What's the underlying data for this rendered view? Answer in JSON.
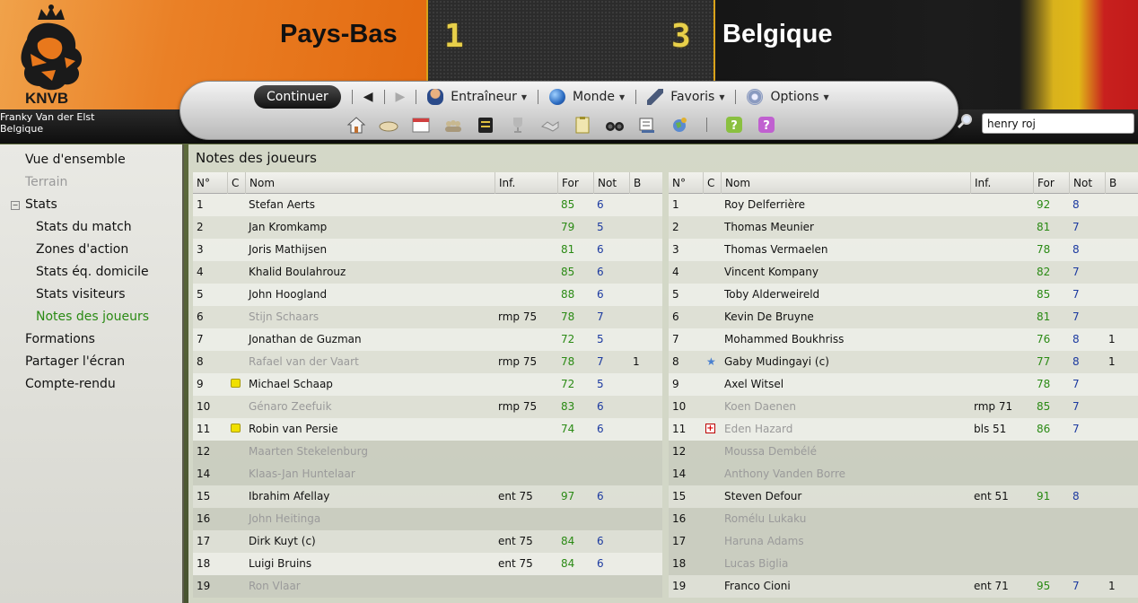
{
  "header": {
    "club_logo_text": "KNVB",
    "home_team": "Pays-Bas",
    "away_team": "Belgique",
    "home_score": "1",
    "away_score": "3",
    "manager_name": "Franky Van der Elst",
    "manager_nation": "Belgique",
    "colors": {
      "home": "#e8761c",
      "score_digits": "#e8d04a",
      "away": "#1a1a1a"
    }
  },
  "toolbar": {
    "continue_label": "Continuer",
    "back_icon": "back-arrow-icon",
    "forward_icon": "forward-arrow-icon",
    "menus": [
      {
        "label": "Entraîneur",
        "icon": "manager-icon"
      },
      {
        "label": "Monde",
        "icon": "globe-icon"
      },
      {
        "label": "Favoris",
        "icon": "pen-icon"
      },
      {
        "label": "Options",
        "icon": "settings-gears-icon"
      }
    ],
    "quick_icons": [
      "home-icon",
      "inbox-icon",
      "calendar-icon",
      "squad-icon",
      "tactics-board-icon",
      "trophy-icon",
      "handshake-icon",
      "notes-clipboard-icon",
      "binoculars-icon",
      "finance-icon",
      "world-icon",
      "help-icon",
      "support-icon"
    ],
    "search_value": "henry roj"
  },
  "sidebar": {
    "items": [
      {
        "label": "Vue d'ensemble",
        "state": "normal"
      },
      {
        "label": "Terrain",
        "state": "dim"
      },
      {
        "label": "Stats",
        "state": "normal"
      },
      {
        "label": "Stats du match",
        "state": "normal"
      },
      {
        "label": "Zones d'action",
        "state": "normal"
      },
      {
        "label": "Stats éq. domicile",
        "state": "normal"
      },
      {
        "label": "Stats visiteurs",
        "state": "normal"
      },
      {
        "label": "Notes des joueurs",
        "state": "active"
      },
      {
        "label": "Formations",
        "state": "normal"
      },
      {
        "label": "Partager l'écran",
        "state": "normal"
      },
      {
        "label": "Compte-rendu",
        "state": "normal"
      }
    ]
  },
  "main": {
    "title": "Notes des joueurs",
    "columns": [
      "N°",
      "C",
      "Nom",
      "Inf.",
      "For",
      "Not",
      "B"
    ],
    "home_rows": [
      {
        "no": "1",
        "c": "",
        "name": "Stefan Aerts",
        "inf": "",
        "for": "85",
        "not": "6",
        "b": "",
        "dim": false
      },
      {
        "no": "2",
        "c": "",
        "name": "Jan Kromkamp",
        "inf": "",
        "for": "79",
        "not": "5",
        "b": "",
        "dim": false
      },
      {
        "no": "3",
        "c": "",
        "name": "Joris Mathijsen",
        "inf": "",
        "for": "81",
        "not": "6",
        "b": "",
        "dim": false
      },
      {
        "no": "4",
        "c": "",
        "name": "Khalid Boulahrouz",
        "inf": "",
        "for": "85",
        "not": "6",
        "b": "",
        "dim": false
      },
      {
        "no": "5",
        "c": "",
        "name": "John Hoogland",
        "inf": "",
        "for": "88",
        "not": "6",
        "b": "",
        "dim": false
      },
      {
        "no": "6",
        "c": "",
        "name": "Stijn Schaars",
        "inf": "rmp 75",
        "for": "78",
        "not": "7",
        "b": "",
        "dim": true
      },
      {
        "no": "7",
        "c": "",
        "name": "Jonathan de Guzman",
        "inf": "",
        "for": "72",
        "not": "5",
        "b": "",
        "dim": false
      },
      {
        "no": "8",
        "c": "",
        "name": "Rafael van der Vaart",
        "inf": "rmp 75",
        "for": "78",
        "not": "7",
        "b": "1",
        "dim": true
      },
      {
        "no": "9",
        "c": "yellow-card",
        "name": "Michael Schaap",
        "inf": "",
        "for": "72",
        "not": "5",
        "b": "",
        "dim": false
      },
      {
        "no": "10",
        "c": "",
        "name": "Génaro Zeefuik",
        "inf": "rmp 75",
        "for": "83",
        "not": "6",
        "b": "",
        "dim": true
      },
      {
        "no": "11",
        "c": "yellow-card",
        "name": "Robin van Persie",
        "inf": "",
        "for": "74",
        "not": "6",
        "b": "",
        "dim": false
      },
      {
        "no": "12",
        "c": "",
        "name": "Maarten Stekelenburg",
        "inf": "",
        "for": "",
        "not": "",
        "b": "",
        "dim": true
      },
      {
        "no": "14",
        "c": "",
        "name": "Klaas-Jan Huntelaar",
        "inf": "",
        "for": "",
        "not": "",
        "b": "",
        "dim": true
      },
      {
        "no": "15",
        "c": "",
        "name": "Ibrahim Afellay",
        "inf": "ent 75",
        "for": "97",
        "not": "6",
        "b": "",
        "dim": false
      },
      {
        "no": "16",
        "c": "",
        "name": "John Heitinga",
        "inf": "",
        "for": "",
        "not": "",
        "b": "",
        "dim": true
      },
      {
        "no": "17",
        "c": "",
        "name": "Dirk Kuyt (c)",
        "inf": "ent 75",
        "for": "84",
        "not": "6",
        "b": "",
        "dim": false
      },
      {
        "no": "18",
        "c": "",
        "name": "Luigi Bruins",
        "inf": "ent 75",
        "for": "84",
        "not": "6",
        "b": "",
        "dim": false
      },
      {
        "no": "19",
        "c": "",
        "name": "Ron Vlaar",
        "inf": "",
        "for": "",
        "not": "",
        "b": "",
        "dim": true
      }
    ],
    "away_rows": [
      {
        "no": "1",
        "c": "",
        "name": "Roy Delferrière",
        "inf": "",
        "for": "92",
        "not": "8",
        "b": "",
        "dim": false
      },
      {
        "no": "2",
        "c": "",
        "name": "Thomas Meunier",
        "inf": "",
        "for": "81",
        "not": "7",
        "b": "",
        "dim": false
      },
      {
        "no": "3",
        "c": "",
        "name": "Thomas Vermaelen",
        "inf": "",
        "for": "78",
        "not": "8",
        "b": "",
        "dim": false
      },
      {
        "no": "4",
        "c": "",
        "name": "Vincent Kompany",
        "inf": "",
        "for": "82",
        "not": "7",
        "b": "",
        "dim": false
      },
      {
        "no": "5",
        "c": "",
        "name": "Toby Alderweireld",
        "inf": "",
        "for": "85",
        "not": "7",
        "b": "",
        "dim": false
      },
      {
        "no": "6",
        "c": "",
        "name": "Kevin De Bruyne",
        "inf": "",
        "for": "81",
        "not": "7",
        "b": "",
        "dim": false
      },
      {
        "no": "7",
        "c": "",
        "name": "Mohammed Boukhriss",
        "inf": "",
        "for": "76",
        "not": "8",
        "b": "1",
        "dim": false
      },
      {
        "no": "8",
        "c": "star",
        "name": "Gaby Mudingayi (c)",
        "inf": "",
        "for": "77",
        "not": "8",
        "b": "1",
        "dim": false
      },
      {
        "no": "9",
        "c": "",
        "name": "Axel Witsel",
        "inf": "",
        "for": "78",
        "not": "7",
        "b": "",
        "dim": false
      },
      {
        "no": "10",
        "c": "",
        "name": "Koen Daenen",
        "inf": "rmp 71",
        "for": "85",
        "not": "7",
        "b": "",
        "dim": true
      },
      {
        "no": "11",
        "c": "injury",
        "name": "Eden Hazard",
        "inf": "bls 51",
        "for": "86",
        "not": "7",
        "b": "",
        "dim": true
      },
      {
        "no": "12",
        "c": "",
        "name": "Moussa Dembélé",
        "inf": "",
        "for": "",
        "not": "",
        "b": "",
        "dim": true
      },
      {
        "no": "14",
        "c": "",
        "name": "Anthony Vanden Borre",
        "inf": "",
        "for": "",
        "not": "",
        "b": "",
        "dim": true
      },
      {
        "no": "15",
        "c": "",
        "name": "Steven Defour",
        "inf": "ent 51",
        "for": "91",
        "not": "8",
        "b": "",
        "dim": false
      },
      {
        "no": "16",
        "c": "",
        "name": "Romélu Lukaku",
        "inf": "",
        "for": "",
        "not": "",
        "b": "",
        "dim": true
      },
      {
        "no": "17",
        "c": "",
        "name": "Haruna Adams",
        "inf": "",
        "for": "",
        "not": "",
        "b": "",
        "dim": true
      },
      {
        "no": "18",
        "c": "",
        "name": "Lucas Biglia",
        "inf": "",
        "for": "",
        "not": "",
        "b": "",
        "dim": true
      },
      {
        "no": "19",
        "c": "",
        "name": "Franco Cioni",
        "inf": "ent 71",
        "for": "95",
        "not": "7",
        "b": "1",
        "dim": false
      }
    ]
  }
}
